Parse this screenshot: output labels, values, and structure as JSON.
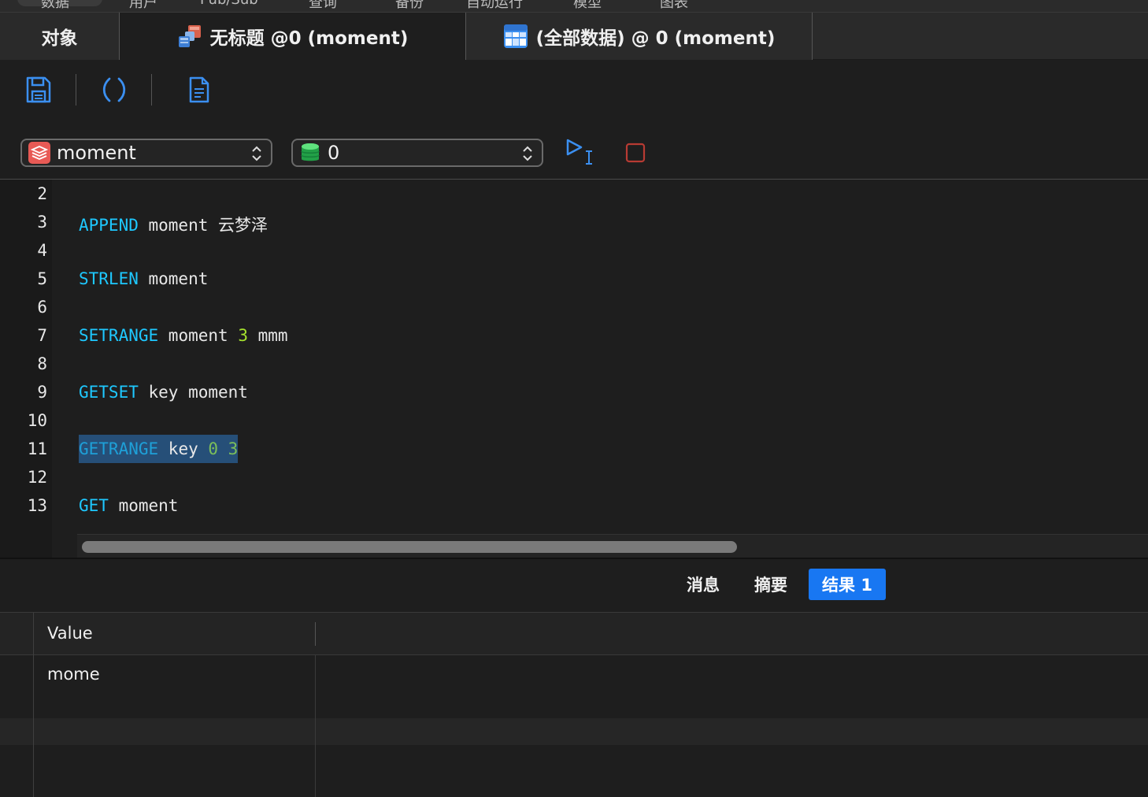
{
  "top_menu": [
    "数据",
    "用户",
    "Pub/Sub",
    "查询",
    "备份",
    "自动运行",
    "模型",
    "图表"
  ],
  "tabs": [
    {
      "label": "对象"
    },
    {
      "label": "无标题 @0 (moment)"
    },
    {
      "label": "(全部数据) @ 0 (moment)"
    }
  ],
  "toolbar": {
    "icons": [
      "save-icon",
      "format-icon",
      "document-icon",
      "run-icon",
      "stop-icon"
    ]
  },
  "connection_select": {
    "value": "moment"
  },
  "database_select": {
    "value": "0"
  },
  "editor": {
    "line_numbers": [
      "2",
      "3",
      "4",
      "5",
      "6",
      "7",
      "8",
      "9",
      "10",
      "11",
      "12",
      "13"
    ],
    "lines": [
      {
        "kw": "",
        "rest": ""
      },
      {
        "kw": "APPEND",
        "rest": " moment 云梦泽"
      },
      {
        "kw": "",
        "rest": ""
      },
      {
        "kw": "STRLEN",
        "rest": " moment"
      },
      {
        "kw": "",
        "rest": ""
      },
      {
        "kw": "SETRANGE",
        "rest": " moment ",
        "num": "3",
        "tail": " mmm"
      },
      {
        "kw": "",
        "rest": ""
      },
      {
        "kw": "GETSET",
        "rest": " key moment"
      },
      {
        "kw": "",
        "rest": ""
      },
      {
        "kw": "GETRANGE",
        "rest": " key ",
        "num": "0 3",
        "tail": ""
      },
      {
        "kw": "",
        "rest": ""
      },
      {
        "kw": "GET",
        "rest": " moment"
      }
    ]
  },
  "result_tabs": [
    {
      "label": "消息"
    },
    {
      "label": "摘要"
    },
    {
      "label": "结果 1"
    }
  ],
  "grid": {
    "columns": [
      "Value"
    ],
    "rows": [
      [
        "mome"
      ]
    ]
  },
  "colors": {
    "keyword": "#1ec8ff",
    "number": "#a6e22e",
    "active_tab": "#1877f2",
    "selection": "#264f78"
  }
}
